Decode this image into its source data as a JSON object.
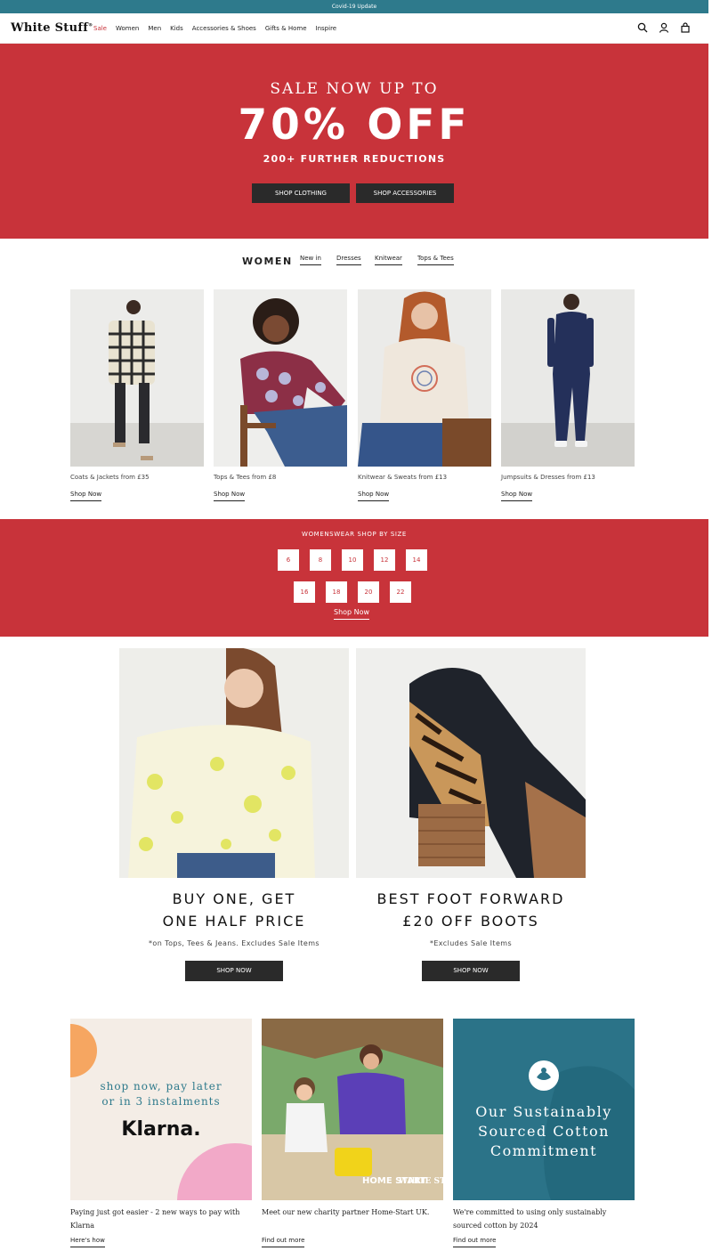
{
  "topbar": {
    "text": "Covid-19 Update"
  },
  "nav": {
    "logo": "White Stuff",
    "menu": [
      "Sale",
      "Women",
      "Men",
      "Kids",
      "Accessories & Shoes",
      "Gifts & Home",
      "Inspire"
    ],
    "icons": [
      "search-icon",
      "account-icon",
      "bag-icon"
    ]
  },
  "hero": {
    "line1": "SALE NOW UP TO",
    "line2": "70% OFF",
    "line3": "200+ FURTHER REDUCTIONS",
    "btn_clothing": "SHOP CLOTHING",
    "btn_accessories": "SHOP ACCESSORIES"
  },
  "women": {
    "title": "WOMEN",
    "links": [
      "New in",
      "Dresses",
      "Knitwear",
      "Tops & Tees"
    ],
    "cards": [
      {
        "caption": "Coats & Jackets from £35",
        "link": "Shop Now"
      },
      {
        "caption": "Tops & Tees from £8",
        "link": "Shop Now"
      },
      {
        "caption": "Knitwear & Sweats from £13",
        "link": "Shop Now"
      },
      {
        "caption": "Jumpsuits & Dresses from £13",
        "link": "Shop Now"
      }
    ]
  },
  "sizes": {
    "title": "WOMENSWEAR SHOP BY SIZE",
    "row1": [
      "6",
      "8",
      "10",
      "12",
      "14"
    ],
    "row2": [
      "16",
      "18",
      "20",
      "22"
    ],
    "link": "Shop Now"
  },
  "promos": [
    {
      "line1": "BUY ONE, GET",
      "line2": "ONE HALF PRICE",
      "note": "*on Tops, Tees & Jeans. Excludes Sale Items",
      "btn": "SHOP NOW"
    },
    {
      "line1": "BEST FOOT FORWARD",
      "line2": "£20 OFF BOOTS",
      "note": "*Excludes Sale Items",
      "btn": "SHOP NOW"
    }
  ],
  "tiles": [
    {
      "art_line1": "shop now, pay later",
      "art_line2": "or in 3 instalments",
      "art_brand": "Klarna.",
      "desc": "Paying just got easier - 2 new ways to pay with Klarna",
      "link": "Here's how"
    },
    {
      "art_sign1": "HOME START",
      "art_sign2": "WHITE STUFF",
      "desc": "Meet our new charity partner Home-Start UK.",
      "link": "Find out more"
    },
    {
      "art_line1": "Our Sustainably",
      "art_line2": "Sourced Cotton",
      "art_line3": "Commitment",
      "desc": "We're committed to using only sustainably sourced cotton by 2024",
      "link": "Find out more"
    }
  ],
  "colors": {
    "brand_red": "#c8333a",
    "teal": "#2e7a8c",
    "dark_button": "#2a2a2a"
  }
}
